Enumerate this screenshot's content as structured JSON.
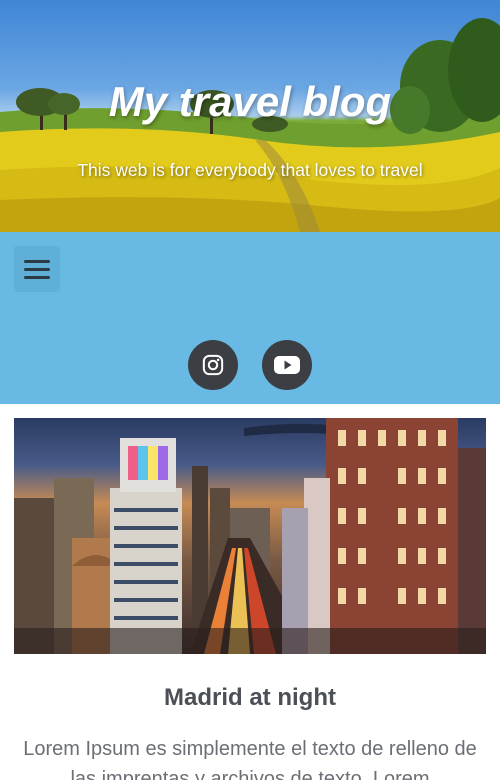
{
  "header": {
    "title": "My travel blog",
    "subtitle": "This web is for everybody that loves to travel"
  },
  "nav": {
    "menu_icon": "hamburger-icon",
    "social": [
      {
        "name": "instagram",
        "icon": "instagram-icon"
      },
      {
        "name": "youtube",
        "icon": "youtube-icon"
      }
    ]
  },
  "post": {
    "title": "Madrid at night",
    "excerpt": "Lorem Ipsum es simplemente el texto de relleno de las imprentas y archivos de texto. Lorem"
  },
  "colors": {
    "nav_band": "#68b9e3",
    "social_button": "#3b3e42",
    "title_text": "#4b4f56",
    "body_text": "#6b6f75"
  }
}
